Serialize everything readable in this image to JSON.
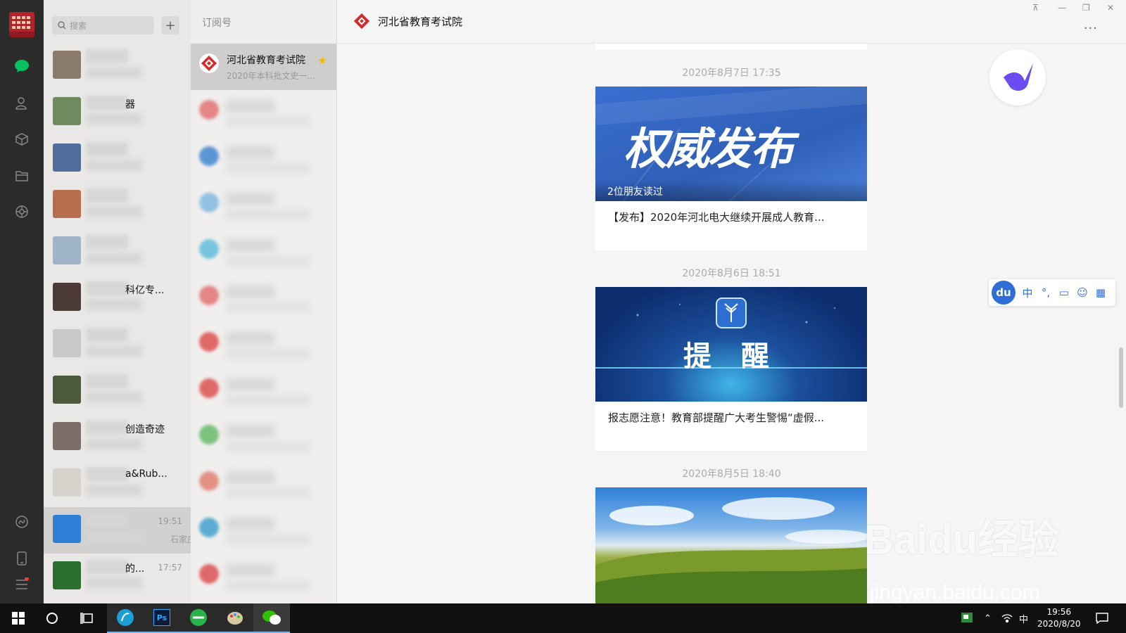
{
  "colors": {
    "accent": "#07c160",
    "brand_red": "#d52a2a",
    "star": "#f5b800",
    "du_blue": "#2d6fd6"
  },
  "search": {
    "placeholder": "搜索"
  },
  "chat_list": [
    {
      "name": "",
      "time": "",
      "preview": "",
      "avatar_color": "#8a7b6c"
    },
    {
      "name": "器",
      "time": "",
      "preview": "",
      "avatar_color": "#6f8a5e"
    },
    {
      "name": "",
      "time": "",
      "preview": "",
      "avatar_color": "#4f6d9c"
    },
    {
      "name": "",
      "time": "",
      "preview": "",
      "avatar_color": "#b86d4c"
    },
    {
      "name": "",
      "time": "",
      "preview": "",
      "avatar_color": "#9fb3c9"
    },
    {
      "name": "科亿专...",
      "time": "",
      "preview": "",
      "avatar_color": "#4b3a36"
    },
    {
      "name": "",
      "time": "",
      "preview": "",
      "avatar_color": "#c9c9c9"
    },
    {
      "name": "",
      "time": "",
      "preview": "",
      "avatar_color": "#4a5a3a"
    },
    {
      "name": "创造奇迹",
      "time": "",
      "preview": "",
      "avatar_color": "#7b6f68"
    },
    {
      "name": "a&Rub...",
      "time": "",
      "preview": "",
      "avatar_color": "#d8d2cc"
    },
    {
      "name": "",
      "time": "19:51",
      "preview": "石家庄...",
      "avatar_color": "#2f7fd6"
    },
    {
      "name": "的...",
      "time": "17:57",
      "preview": "",
      "avatar_color": "#2c6e2f"
    }
  ],
  "subscriptions": {
    "header": "订阅号",
    "items": [
      {
        "name": "河北省教育考试院",
        "preview": "2020年本科批文史一...",
        "starred": true
      }
    ]
  },
  "main": {
    "title": "河北省教育考试院",
    "more": "···",
    "posts": [
      {
        "date": "2020年8月7日 17:35",
        "banner_text": "权威发布",
        "friends_read": "2位朋友读过",
        "title": "【发布】2020年河北电大继续开展成人教育..."
      },
      {
        "date": "2020年8月6日 18:51",
        "banner_text": "提 醒",
        "friends_read": "",
        "title": "报志愿注意！教育部提醒广大考生警惕“虚假..."
      },
      {
        "date": "2020年8月5日 18:40",
        "banner_text": "",
        "friends_read": "",
        "title": ""
      }
    ]
  },
  "du_toolbar": {
    "logo": "du",
    "tools": [
      "中",
      "°,",
      "▭",
      "☺",
      "▦"
    ]
  },
  "watermark": {
    "line1": "Baidu经验",
    "line2": "jingyan.baidu.com"
  },
  "taskbar": {
    "tray_ime": "中",
    "time": "19:56",
    "date": "2020/8/20"
  }
}
